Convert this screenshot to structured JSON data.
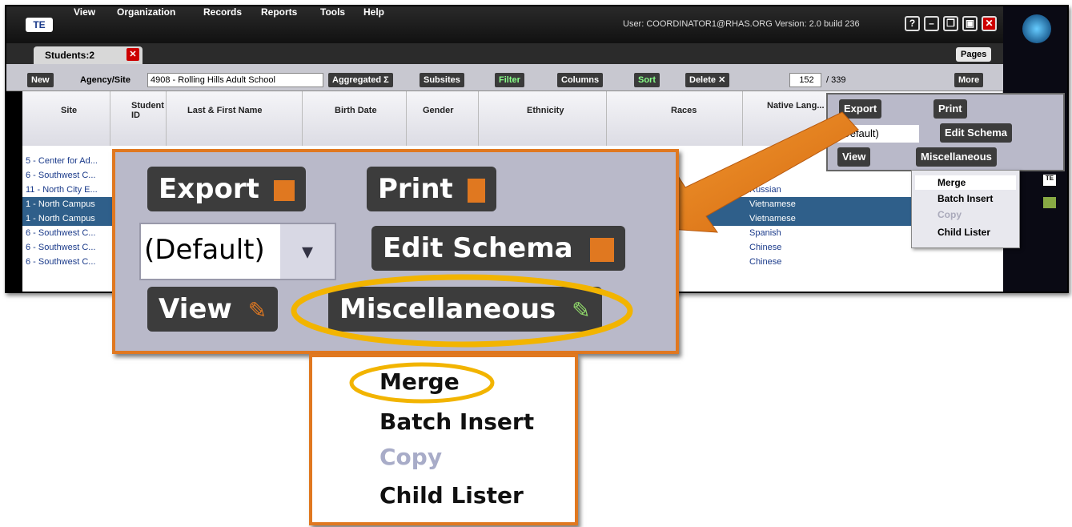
{
  "menubar": {
    "logo": "TE",
    "items": [
      "View",
      "Organization",
      "Records",
      "Reports",
      "Tools",
      "Help"
    ],
    "user_info": "User: COORDINATOR1@RHAS.ORG  Version: 2.0 build 236",
    "window_buttons": [
      "?",
      "–",
      "❐",
      "▣",
      "✕"
    ]
  },
  "tabs": {
    "active_label": "Students:2",
    "close": "✕",
    "pages_label": "Pages"
  },
  "toolbar": {
    "new_label": "New",
    "agency_label": "Agency/Site",
    "agency_value": "4908 - Rolling Hills Adult School",
    "aggregated_label": "Aggregated Σ",
    "subsites_label": "Subsites",
    "filter_label": "Filter",
    "columns_label": "Columns",
    "sort_label": "Sort",
    "delete_label": "Delete ✕",
    "page_current": "152",
    "page_total": "/ 339",
    "more_label": "More"
  },
  "grid": {
    "columns": [
      "Site",
      "Student ID",
      "Last & First Name",
      "Birth Date",
      "Gender",
      "Ethnicity",
      "Races",
      "Native Lang..."
    ],
    "sites": [
      "5 - Center for Ad...",
      "6 - Southwest C...",
      "11 - North City E...",
      "1 - North Campus",
      "1 - North Campus",
      "6 - Southwest C...",
      "6 - Southwest C...",
      "6 - Southwest C..."
    ],
    "languages": [
      "",
      "...sian",
      "Russian",
      "Vietnamese",
      "Vietnamese",
      "Spanish",
      "Chinese",
      "Chinese"
    ],
    "selected_rows": [
      3,
      4
    ]
  },
  "popup": {
    "export_label": "Export",
    "print_label": "Print",
    "schema_value": "(Default)",
    "edit_schema_label": "Edit Schema",
    "view_label": "View",
    "misc_label": "Miscellaneous"
  },
  "misc_menu": {
    "items": [
      "Merge",
      "Batch Insert",
      "Copy",
      "Child Lister"
    ],
    "disabled": [
      "Copy"
    ],
    "highlighted": "Merge"
  },
  "colors": {
    "accent": "#e07820",
    "highlight_ring": "#f2b400",
    "selected_row": "#2f5f8a"
  }
}
